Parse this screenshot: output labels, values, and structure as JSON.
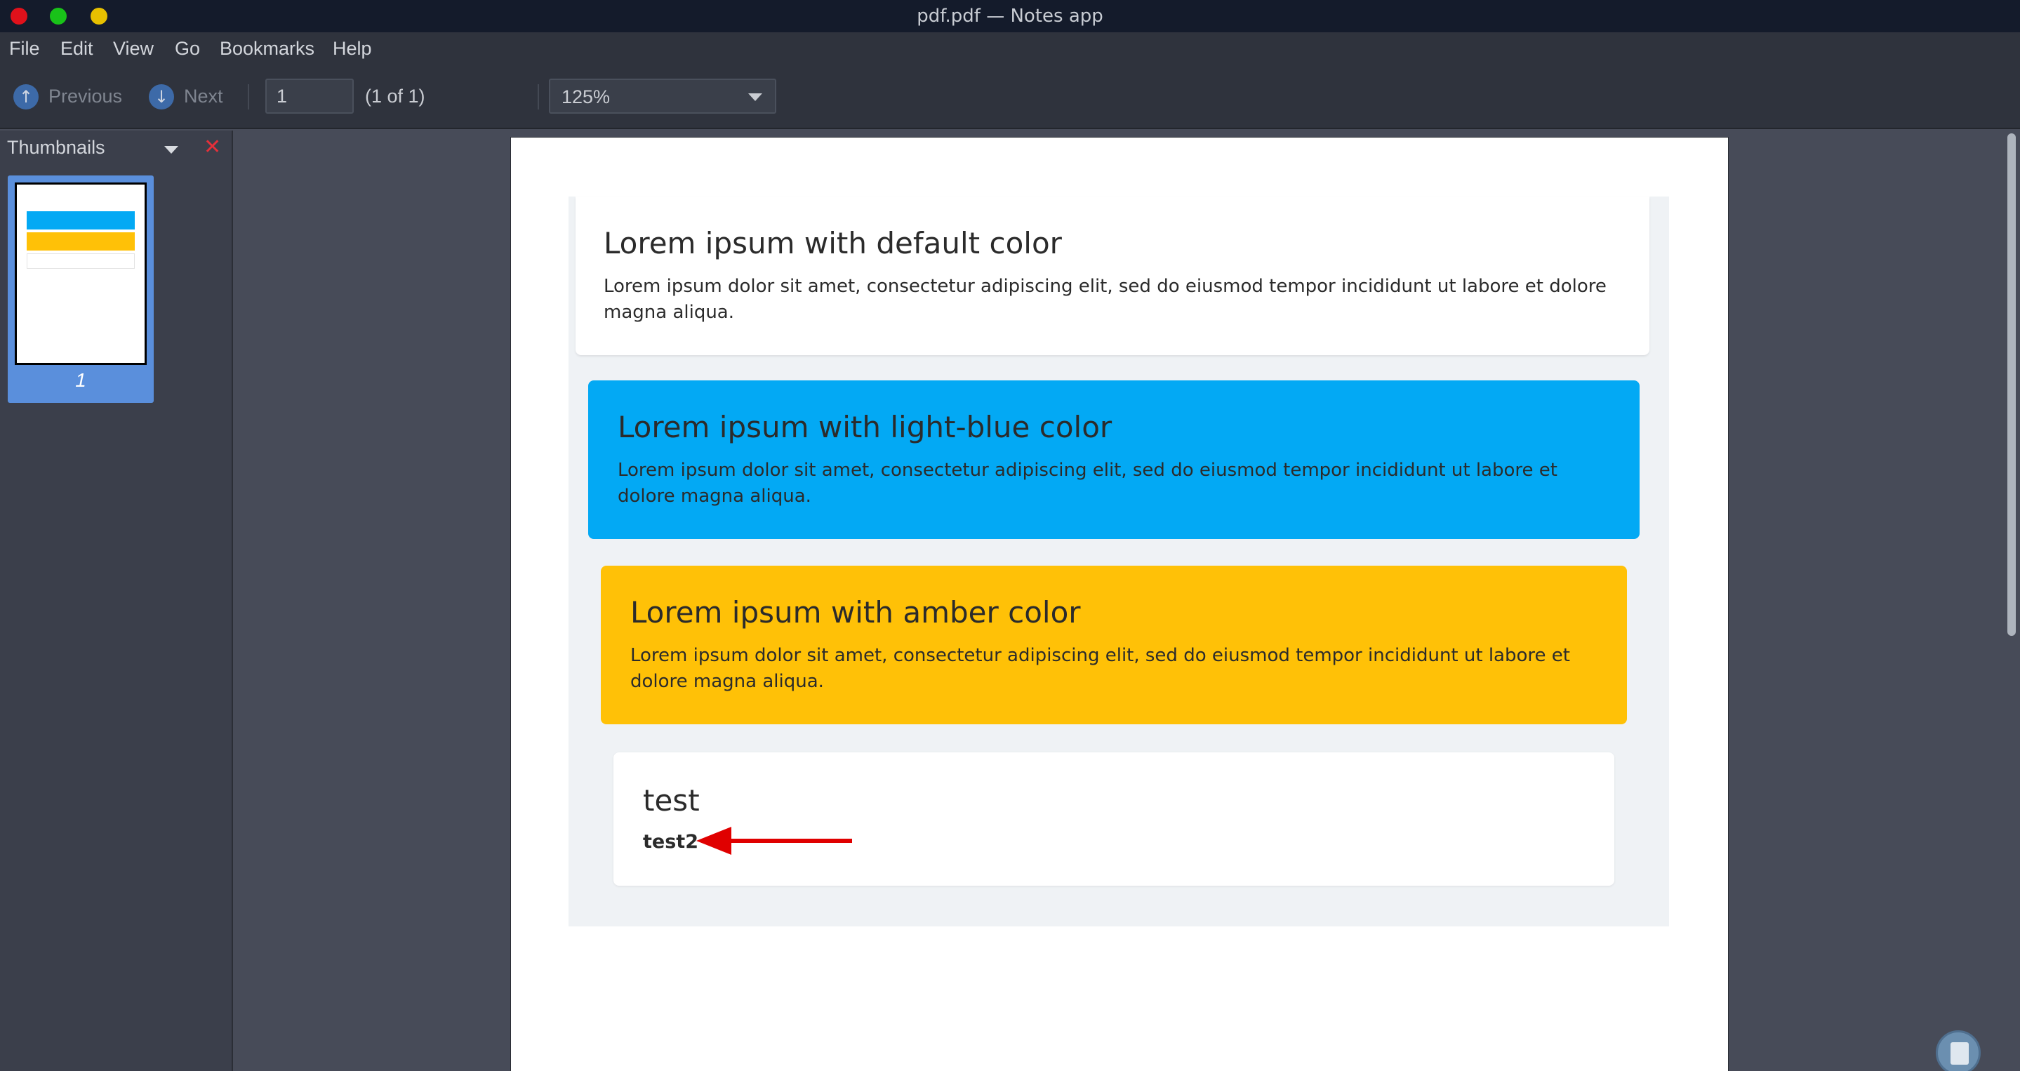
{
  "window": {
    "title": "pdf.pdf — Notes app"
  },
  "menu": [
    "File",
    "Edit",
    "View",
    "Go",
    "Bookmarks",
    "Help"
  ],
  "toolbar": {
    "previous_label": "Previous",
    "next_label": "Next",
    "page_value": "1",
    "page_count": "(1 of 1)",
    "zoom_value": "125%"
  },
  "sidebar": {
    "title": "Thumbnails",
    "thumbnail_page_number": "1"
  },
  "document": {
    "cards": [
      {
        "title": "Lorem ipsum with default color",
        "body": "Lorem ipsum dolor sit amet, consectetur adipiscing elit, sed do eiusmod tempor incididunt ut labore et dolore magna aliqua.",
        "color": "#ffffff"
      },
      {
        "title": "Lorem ipsum with light-blue color",
        "body": "Lorem ipsum dolor sit amet, consectetur adipiscing elit, sed do eiusmod tempor incididunt ut labore et dolore magna aliqua.",
        "color": "#03a9f4"
      },
      {
        "title": "Lorem ipsum with amber color",
        "body": "Lorem ipsum dolor sit amet, consectetur adipiscing elit, sed do eiusmod tempor incididunt ut labore et dolore magna aliqua.",
        "color": "#ffc107"
      }
    ],
    "test_card": {
      "title": "test",
      "subtitle": "test2"
    }
  },
  "colors": {
    "accent": "#5a8fdc",
    "close": "#e5303a",
    "arrow": "#e00000"
  }
}
